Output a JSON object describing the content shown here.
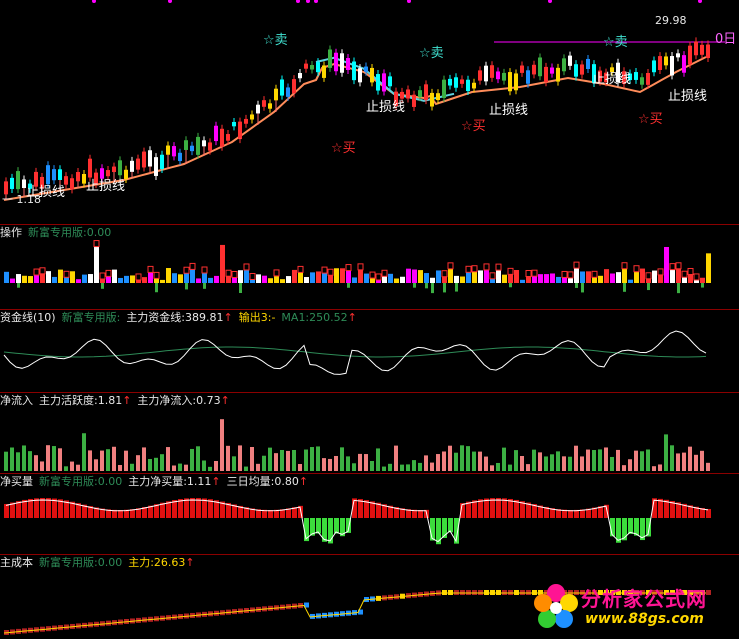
{
  "colors": {
    "up": "#ff3030",
    "down": "#00ffff",
    "cost_line": "#ff8c5a",
    "divider": "#8b0000",
    "yellow": "#ffd700",
    "magenta": "#ff00ff",
    "green": "#3cb043",
    "pink": "#f08080",
    "white": "#ffffff",
    "blue": "#1e90ff"
  },
  "main": {
    "price_high": "29.98",
    "right_edge_label": "0日",
    "bottom_left_label": "一 1.18",
    "signals": {
      "sell": [
        "☆卖",
        "☆卖",
        "☆卖"
      ],
      "buy": [
        "☆买",
        "☆买",
        "☆买"
      ],
      "stop": [
        "止损线",
        "止损线",
        "止损线",
        "止损线",
        "止损线"
      ]
    }
  },
  "panels": {
    "p1": {
      "name": "操作",
      "ver": "新富专用版:0.00"
    },
    "p2": {
      "name": "资金线(10)",
      "ver": "新富专用版:",
      "main_label": "主力资金线:389.81",
      "arrow": "↑",
      "out_label": "输出3:-",
      "ma_label": "MA1:250.52",
      "ma_arrow": "↑"
    },
    "p3": {
      "name": "净流入",
      "act_label": "主力活跃度:1.81",
      "act_arrow": "↑",
      "flow_label": "主力净流入:0.73",
      "flow_arrow": "↑"
    },
    "p4": {
      "name": "净买量",
      "ver": "新富专用版:0.00",
      "net_label": "主力净买量:1.11",
      "net_arrow": "↑",
      "avg_label": "三日均量:0.80",
      "avg_arrow": "↑"
    },
    "p5": {
      "name": "主成本",
      "ver": "新富专用版:0.00",
      "cost_label": "主力:26.63",
      "cost_arrow": "↑"
    }
  },
  "watermark": {
    "title": "分析家公式网",
    "url": "www.88gs.com"
  }
}
